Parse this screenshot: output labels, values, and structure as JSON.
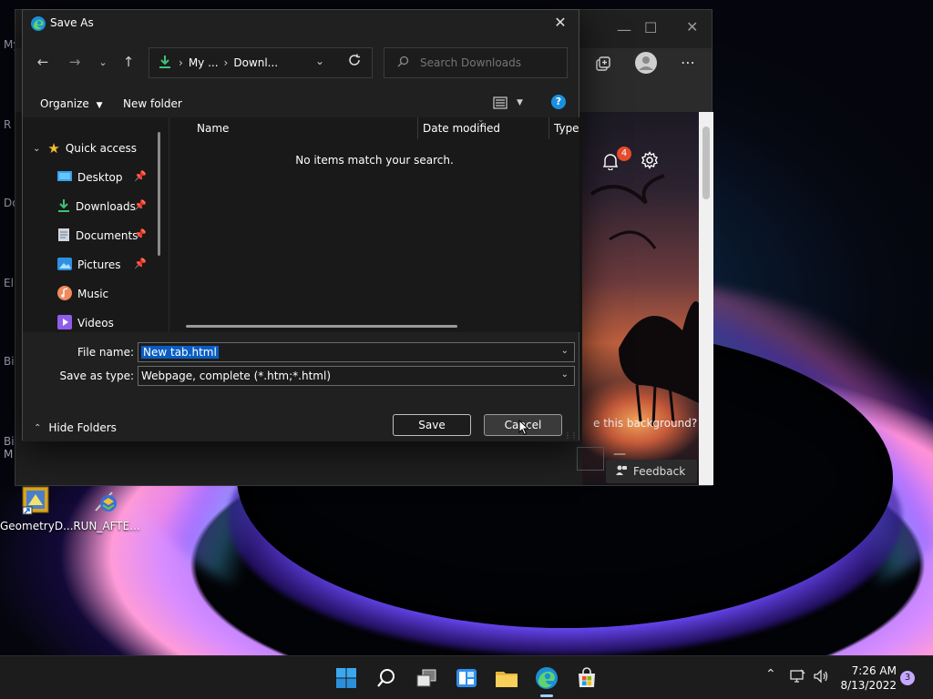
{
  "desktop": {
    "edge_letters": [
      "My",
      "R",
      "Do",
      "El",
      "Bi",
      "Bi",
      "M"
    ],
    "icons": [
      {
        "label": "GeometryD..."
      },
      {
        "label": "RUN_AFTE..."
      }
    ]
  },
  "browser": {
    "notification_count": "4",
    "background_prompt": "e this background?",
    "feedback_label": "Feedback"
  },
  "dialog": {
    "title": "Save As",
    "breadcrumb": [
      "My ...",
      "Downl..."
    ],
    "search_placeholder": "Search Downloads",
    "organize_label": "Organize",
    "new_folder_label": "New folder",
    "sidebar": {
      "quick_access": "Quick access",
      "items": [
        {
          "label": "Desktop",
          "pinned": true
        },
        {
          "label": "Downloads",
          "pinned": true
        },
        {
          "label": "Documents",
          "pinned": true
        },
        {
          "label": "Pictures",
          "pinned": true
        },
        {
          "label": "Music",
          "pinned": false
        },
        {
          "label": "Videos",
          "pinned": false
        }
      ]
    },
    "columns": [
      "Name",
      "Date modified",
      "Type"
    ],
    "empty_message": "No items match your search.",
    "file_name_label": "File name:",
    "file_name_value": "New tab.html",
    "save_type_label": "Save as type:",
    "save_type_value": "Webpage, complete (*.htm;*.html)",
    "save_label": "Save",
    "cancel_label": "Cancel",
    "hide_folders_label": "Hide Folders"
  },
  "taskbar": {
    "apps": [
      "start",
      "search",
      "task-view",
      "widgets",
      "file-explorer",
      "edge",
      "store"
    ],
    "time": "7:26 AM",
    "date": "8/13/2022",
    "notification_count": "3"
  },
  "colors": {
    "accent": "#0a5ec2",
    "help": "#1a8fe0",
    "badge": "#e74c2c"
  }
}
